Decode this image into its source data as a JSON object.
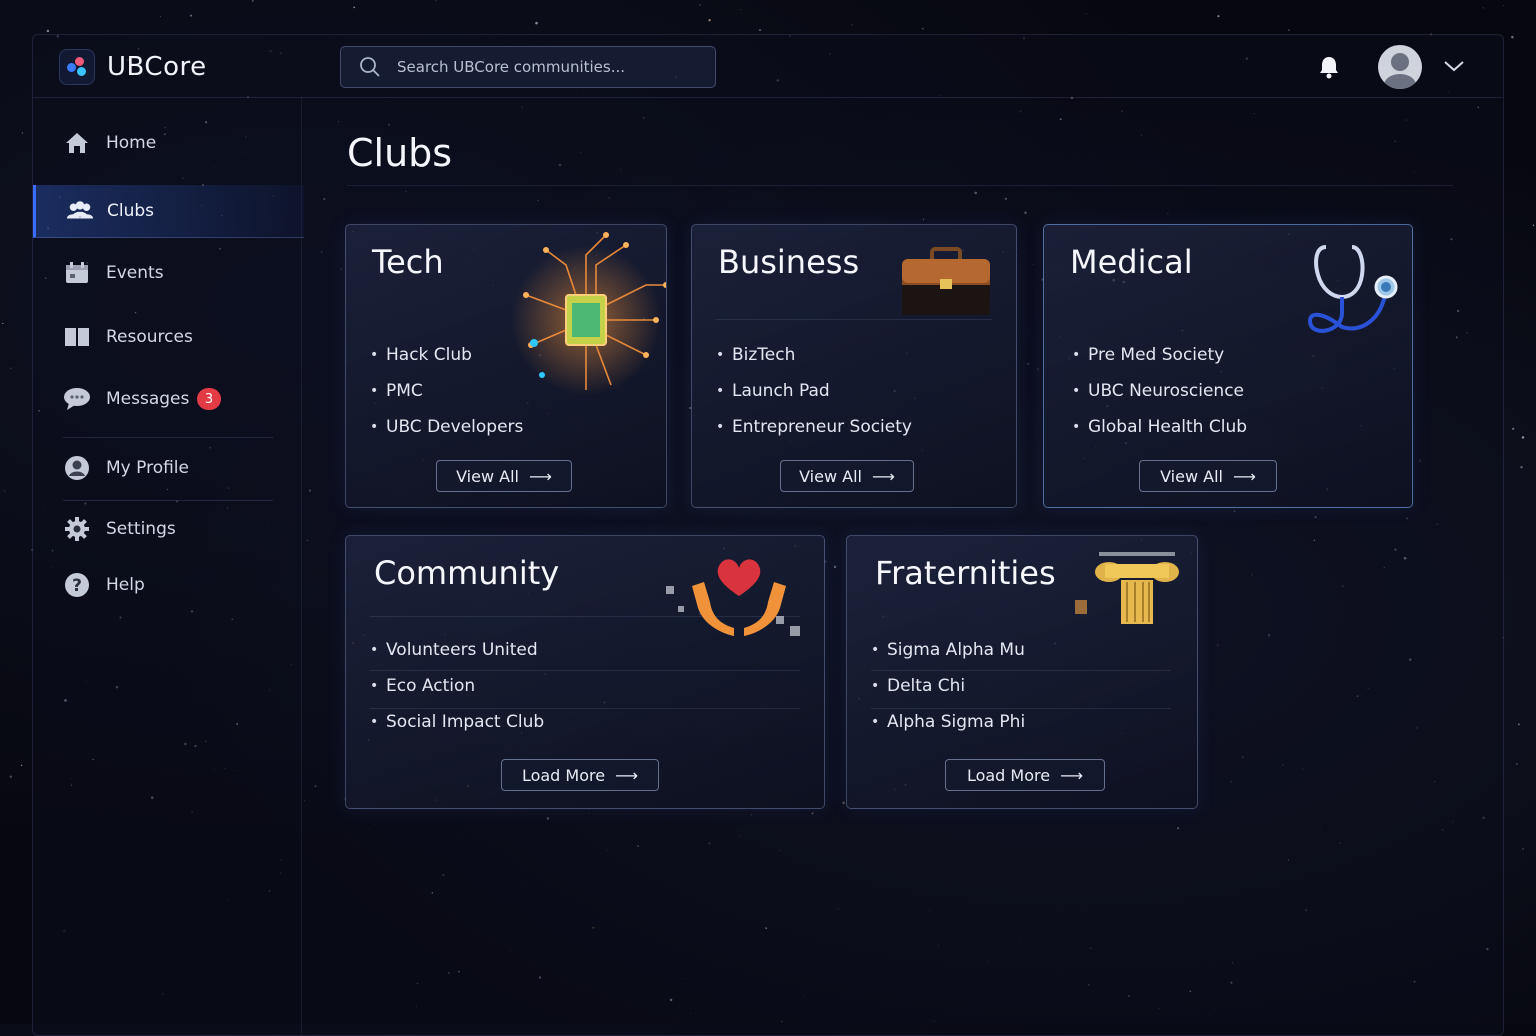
{
  "app": {
    "name": "UBCore"
  },
  "search": {
    "placeholder": "Search UBCore communities..."
  },
  "sidebar": {
    "items": [
      {
        "label": "Home",
        "icon": "home-icon"
      },
      {
        "label": "Clubs",
        "icon": "users-icon",
        "active": true
      },
      {
        "label": "Events",
        "icon": "calendar-icon"
      },
      {
        "label": "Resources",
        "icon": "book-icon"
      },
      {
        "label": "Messages",
        "icon": "chat-icon",
        "badge": "3"
      },
      {
        "label": "My Profile",
        "icon": "user-icon"
      },
      {
        "label": "Settings",
        "icon": "gear-icon"
      },
      {
        "label": "Help",
        "icon": "help-icon"
      }
    ]
  },
  "main": {
    "title": "Clubs",
    "cards": [
      {
        "title": "Tech",
        "items": [
          "Hack Club",
          "PMC",
          "UBC Developers"
        ],
        "button": "View All",
        "art": "circuit-chip-icon"
      },
      {
        "title": "Business",
        "items": [
          "BizTech",
          "Launch Pad",
          "Entrepreneur Society"
        ],
        "button": "View All",
        "art": "briefcase-icon"
      },
      {
        "title": "Medical",
        "items": [
          "Pre Med Society",
          "UBC Neuroscience",
          "Global Health Club"
        ],
        "button": "View All",
        "art": "stethoscope-icon"
      },
      {
        "title": "Community",
        "items": [
          "Volunteers United",
          "Eco Action",
          "Social Impact Club"
        ],
        "button": "Load More",
        "art": "heart-hands-icon"
      },
      {
        "title": "Fraternities",
        "items": [
          "Sigma Alpha Mu",
          "Delta Chi",
          "Alpha Sigma Phi"
        ],
        "button": "Load More",
        "art": "column-icon"
      }
    ]
  },
  "colors": {
    "accent": "#3a6cff",
    "badge": "#e23b46",
    "background": "#07080f"
  }
}
